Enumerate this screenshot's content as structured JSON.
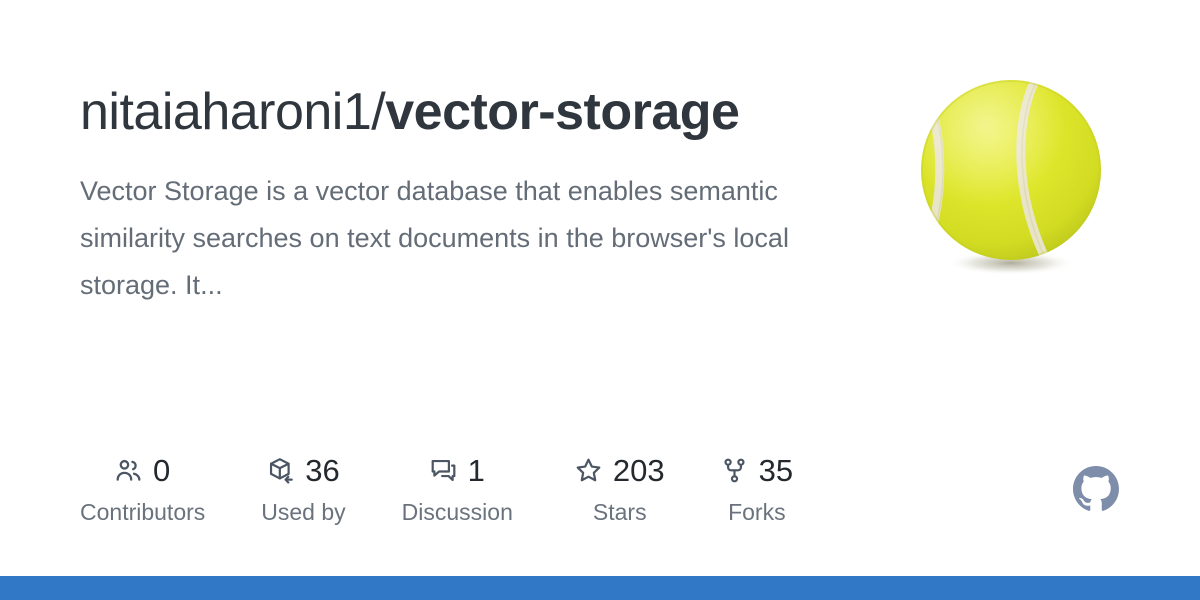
{
  "repository": {
    "owner": "nitaiaharoni1",
    "separator": "/",
    "name": "vector-storage",
    "description": "Vector Storage is a vector database that enables semantic similarity searches on text documents in the browser's local storage. It..."
  },
  "stats": [
    {
      "icon": "people-icon",
      "value": "0",
      "label": "Contributors"
    },
    {
      "icon": "package-icon",
      "value": "36",
      "label": "Used by"
    },
    {
      "icon": "discussion-icon",
      "value": "1",
      "label": "Discussion"
    },
    {
      "icon": "star-icon",
      "value": "203",
      "label": "Stars"
    },
    {
      "icon": "fork-icon",
      "value": "35",
      "label": "Forks"
    }
  ],
  "branding": {
    "logo_icon": "github-mark-icon",
    "logo_color": "#7e8da9",
    "preview_image": "tennis-ball-image",
    "accent_bar_color": "#3178c6"
  },
  "colors": {
    "title": "#2f363d",
    "description": "#646d77",
    "stat_value": "#24292f",
    "stat_label": "#6a737d",
    "ball_body": "#dde529",
    "ball_seam": "#e9e5cf",
    "background": "#ffffff"
  }
}
